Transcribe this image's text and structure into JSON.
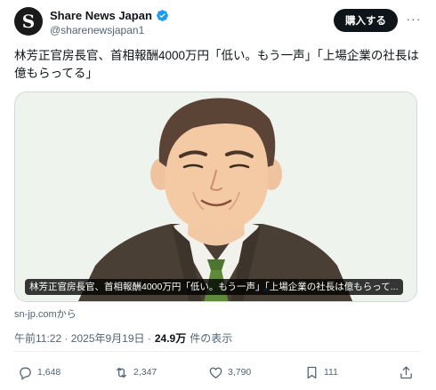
{
  "post": {
    "avatar_letter": "S",
    "author_name": "Share News Japan",
    "handle": "@sharenewsjapan1",
    "buy_label": "購入する",
    "more_label": "···",
    "text": "林芳正官房長官、首相報酬4000万円「低い。もう一声」「上場企業の社長は億もらってる」",
    "card": {
      "caption": "林芳正官房長官、首相報酬4000万円「低い。もう一声」「上場企業の社長は億もらって...",
      "source": "sn-jp.comから"
    },
    "timestamp": "午前11:22 · 2025年9月19日 ·",
    "views_count": "24.9万",
    "views_label": "件の表示"
  },
  "actions": {
    "reply_count": "1,648",
    "repost_count": "2,347",
    "like_count": "3,790",
    "bookmark_count": "111"
  },
  "colors": {
    "verified_badge": "#1d9bf0",
    "text_primary": "#0f1419",
    "text_secondary": "#536471",
    "card_background": "#eef3ee",
    "suit": "#4a3f35",
    "tie": "#5e8a3a"
  },
  "icons": [
    "verified-badge-icon",
    "more-icon",
    "reply-icon",
    "repost-icon",
    "like-icon",
    "bookmark-icon",
    "share-icon"
  ]
}
